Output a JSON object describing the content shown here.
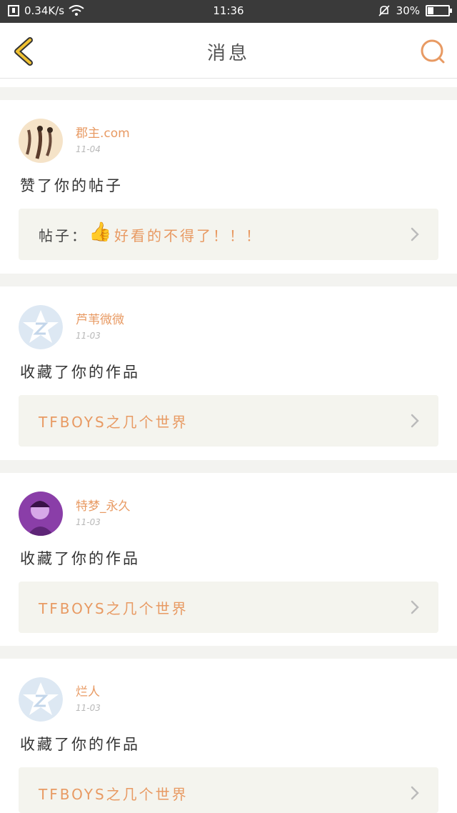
{
  "status_bar": {
    "speed": "0.34K/s",
    "time": "11:36",
    "battery": "30%",
    "battery_level": 0.3
  },
  "nav": {
    "title": "消息",
    "back_icon": "chevron-left-icon",
    "search_icon": "search-icon"
  },
  "notifications": [
    {
      "user": "郡主.com",
      "date": "11-04",
      "action": "赞了你的帖子",
      "ref_prefix": "帖子：",
      "ref_emoji": "👍",
      "ref_text": "好看的不得了！！！",
      "avatar": "photo"
    },
    {
      "user": "芦苇微微",
      "date": "11-03",
      "action": "收藏了你的作品",
      "ref_text": "TFBOYS之几个世界",
      "avatar": "default"
    },
    {
      "user": "特梦_永久",
      "date": "11-03",
      "action": "收藏了你的作品",
      "ref_text": "TFBOYS之几个世界",
      "avatar": "purple-photo"
    },
    {
      "user": "烂人",
      "date": "11-03",
      "action": "收藏了你的作品",
      "ref_text": "TFBOYS之几个世界",
      "avatar": "default"
    }
  ],
  "colors": {
    "accent": "#e89a63",
    "back_icon": "#f1c232",
    "status_bar_bg": "#3a3a3a",
    "ref_bg": "#f4f4ee"
  }
}
